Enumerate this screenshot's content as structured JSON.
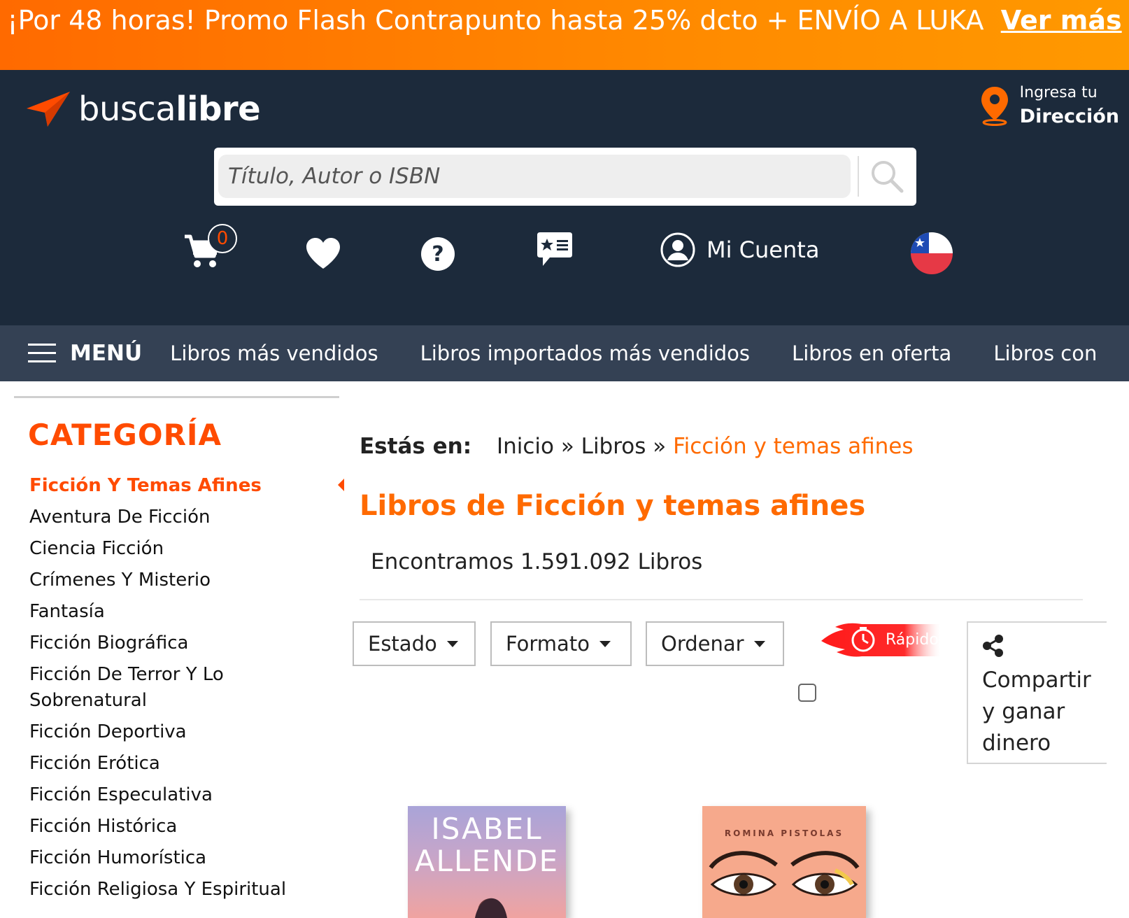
{
  "promo": {
    "text": "¡Por 48 horas! Promo Flash Contrapunto hasta 25% dcto + ENVÍO A LUKA",
    "link": "Ver más"
  },
  "header": {
    "logo_prefix": "busca",
    "logo_suffix": "libre",
    "address_small": "Ingresa tu",
    "address_big": "Dirección",
    "search_placeholder": "Título, Autor o ISBN",
    "cart_count": "0",
    "account_label": "Mi Cuenta",
    "country_flag": "chile-flag-icon"
  },
  "nav": {
    "menu_label": "MENÚ",
    "links": [
      "Libros más vendidos",
      "Libros importados más vendidos",
      "Libros en oferta",
      "Libros con e"
    ]
  },
  "sidebar": {
    "title": "CATEGORÍA",
    "items": [
      "Ficción Y Temas Afines",
      "Aventura De Ficción",
      "Ciencia Ficción",
      "Crímenes Y Misterio",
      "Fantasía",
      "Ficción Biográfica",
      "Ficción De Terror Y Lo Sobrenatural",
      "Ficción Deportiva",
      "Ficción Erótica",
      "Ficción Especulativa",
      "Ficción Histórica",
      "Ficción Humorística",
      "Ficción Religiosa Y Espiritual"
    ]
  },
  "main": {
    "breadcrumb_label": "Estás en:",
    "breadcrumb_path": "Inicio » Libros »",
    "breadcrumb_current": "Ficción y temas afines",
    "title": "Libros de Ficción y temas afines",
    "count": "Encontramos 1.591.092 Libros",
    "filters": [
      "Estado",
      "Formato",
      "Ordenar"
    ],
    "rapido_label": "Rápido",
    "share_label": "Compartir y ganar dinero"
  },
  "books": [
    {
      "cover_text": "ISABEL ALLENDE"
    },
    {
      "cover_text": "ROMINA PISTOLAS"
    }
  ],
  "colors": {
    "accent": "#ff4b00",
    "header_bg": "#1c2a3b",
    "nav_bg": "#344154"
  }
}
